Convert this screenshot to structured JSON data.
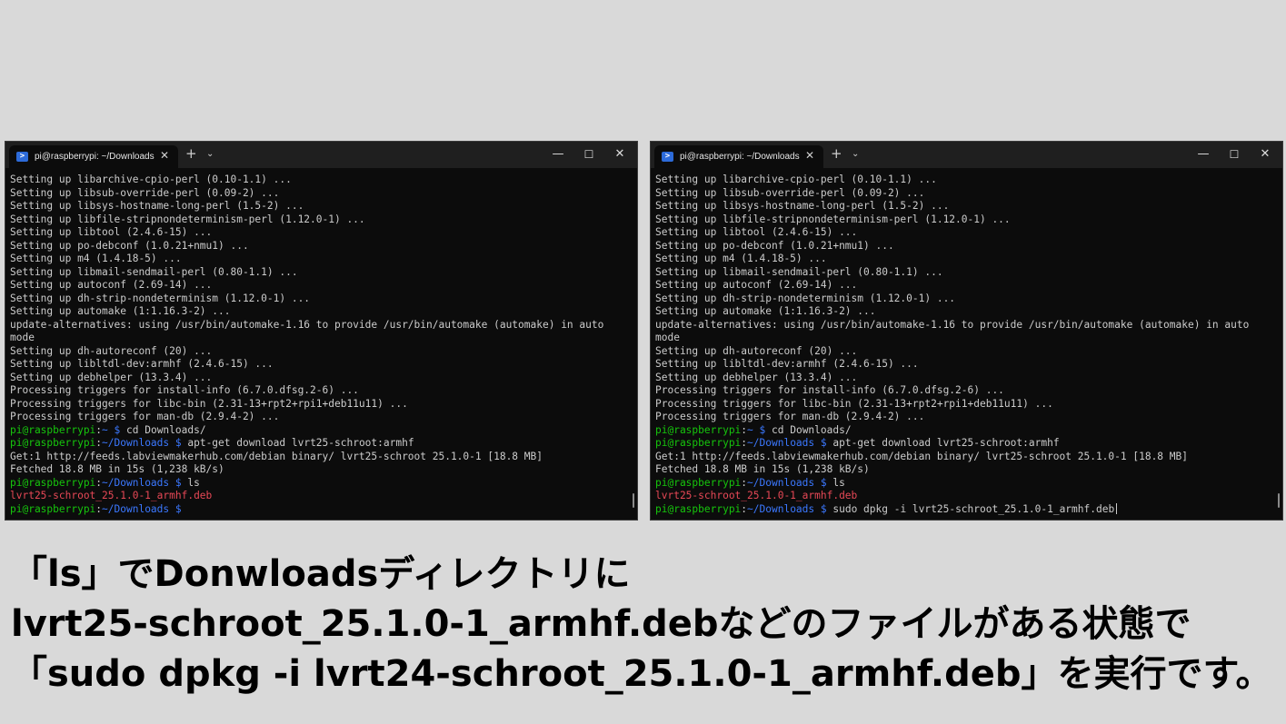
{
  "terminal_left": {
    "tab_title": "pi@raspberrypi: ~/Downloads",
    "tab_close": "✕",
    "new_tab": "+",
    "dropdown": "⌄",
    "minimize": "—",
    "maximize": "☐",
    "close": "✕",
    "lines": [
      {
        "text": "Setting up libarchive-cpio-perl (0.10-1.1) ..."
      },
      {
        "text": "Setting up libsub-override-perl (0.09-2) ..."
      },
      {
        "text": "Setting up libsys-hostname-long-perl (1.5-2) ..."
      },
      {
        "text": "Setting up libfile-stripnondeterminism-perl (1.12.0-1) ..."
      },
      {
        "text": "Setting up libtool (2.4.6-15) ..."
      },
      {
        "text": "Setting up po-debconf (1.0.21+nmu1) ..."
      },
      {
        "text": "Setting up m4 (1.4.18-5) ..."
      },
      {
        "text": "Setting up libmail-sendmail-perl (0.80-1.1) ..."
      },
      {
        "text": "Setting up autoconf (2.69-14) ..."
      },
      {
        "text": "Setting up dh-strip-nondeterminism (1.12.0-1) ..."
      },
      {
        "text": "Setting up automake (1:1.16.3-2) ..."
      },
      {
        "text": "update-alternatives: using /usr/bin/automake-1.16 to provide /usr/bin/automake (automake) in auto"
      },
      {
        "text": "mode"
      },
      {
        "text": "Setting up dh-autoreconf (20) ..."
      },
      {
        "text": "Setting up libltdl-dev:armhf (2.4.6-15) ..."
      },
      {
        "text": "Setting up debhelper (13.3.4) ..."
      },
      {
        "text": "Processing triggers for install-info (6.7.0.dfsg.2-6) ..."
      },
      {
        "text": "Processing triggers for libc-bin (2.31-13+rpt2+rpi1+deb11u11) ..."
      },
      {
        "text": "Processing triggers for man-db (2.9.4-2) ..."
      },
      {
        "user": "pi@raspberrypi",
        "path": "~",
        "command": "cd Downloads/"
      },
      {
        "user": "pi@raspberrypi",
        "path": "~/Downloads",
        "command": "apt-get download lvrt25-schroot:armhf"
      },
      {
        "text": "Get:1 http://feeds.labviewmakerhub.com/debian binary/ lvrt25-schroot 25.1.0-1 [18.8 MB]"
      },
      {
        "text": "Fetched 18.8 MB in 15s (1,238 kB/s)"
      },
      {
        "user": "pi@raspberrypi",
        "path": "~/Downloads",
        "command": "ls"
      },
      {
        "file": "lvrt25-schroot_25.1.0-1_armhf.deb"
      },
      {
        "user": "pi@raspberrypi",
        "path": "~/Downloads",
        "command": ""
      }
    ]
  },
  "terminal_right": {
    "tab_title": "pi@raspberrypi: ~/Downloads",
    "tab_close": "✕",
    "new_tab": "+",
    "dropdown": "⌄",
    "minimize": "—",
    "maximize": "☐",
    "close": "✕",
    "lines": [
      {
        "text": "Setting up libarchive-cpio-perl (0.10-1.1) ..."
      },
      {
        "text": "Setting up libsub-override-perl (0.09-2) ..."
      },
      {
        "text": "Setting up libsys-hostname-long-perl (1.5-2) ..."
      },
      {
        "text": "Setting up libfile-stripnondeterminism-perl (1.12.0-1) ..."
      },
      {
        "text": "Setting up libtool (2.4.6-15) ..."
      },
      {
        "text": "Setting up po-debconf (1.0.21+nmu1) ..."
      },
      {
        "text": "Setting up m4 (1.4.18-5) ..."
      },
      {
        "text": "Setting up libmail-sendmail-perl (0.80-1.1) ..."
      },
      {
        "text": "Setting up autoconf (2.69-14) ..."
      },
      {
        "text": "Setting up dh-strip-nondeterminism (1.12.0-1) ..."
      },
      {
        "text": "Setting up automake (1:1.16.3-2) ..."
      },
      {
        "text": "update-alternatives: using /usr/bin/automake-1.16 to provide /usr/bin/automake (automake) in auto"
      },
      {
        "text": "mode"
      },
      {
        "text": "Setting up dh-autoreconf (20) ..."
      },
      {
        "text": "Setting up libltdl-dev:armhf (2.4.6-15) ..."
      },
      {
        "text": "Setting up debhelper (13.3.4) ..."
      },
      {
        "text": "Processing triggers for install-info (6.7.0.dfsg.2-6) ..."
      },
      {
        "text": "Processing triggers for libc-bin (2.31-13+rpt2+rpi1+deb11u11) ..."
      },
      {
        "text": "Processing triggers for man-db (2.9.4-2) ..."
      },
      {
        "user": "pi@raspberrypi",
        "path": "~",
        "command": "cd Downloads/"
      },
      {
        "user": "pi@raspberrypi",
        "path": "~/Downloads",
        "command": "apt-get download lvrt25-schroot:armhf"
      },
      {
        "text": "Get:1 http://feeds.labviewmakerhub.com/debian binary/ lvrt25-schroot 25.1.0-1 [18.8 MB]"
      },
      {
        "text": "Fetched 18.8 MB in 15s (1,238 kB/s)"
      },
      {
        "user": "pi@raspberrypi",
        "path": "~/Downloads",
        "command": "ls"
      },
      {
        "file": "lvrt25-schroot_25.1.0-1_armhf.deb"
      },
      {
        "user": "pi@raspberrypi",
        "path": "~/Downloads",
        "command": "sudo dpkg -i lvrt25-schroot_25.1.0-1_armhf.deb",
        "cursor": true
      }
    ]
  },
  "caption": {
    "line1": "「ls」でDonwloadsディレクトリに",
    "line2": "lvrt25-schroot_25.1.0-1_armhf.debなどのファイルがある状態で",
    "line3": "「sudo dpkg -i lvrt24-schroot_25.1.0-1_armhf.deb」を実行です。"
  },
  "colors": {
    "background": "#d9d9d9",
    "terminal_bg": "#0c0c0c",
    "titlebar_bg": "#1f1f1f",
    "text": "#cccccc",
    "prompt_user": "#16c60c",
    "prompt_path": "#3b78ff",
    "file_red": "#e74856"
  }
}
